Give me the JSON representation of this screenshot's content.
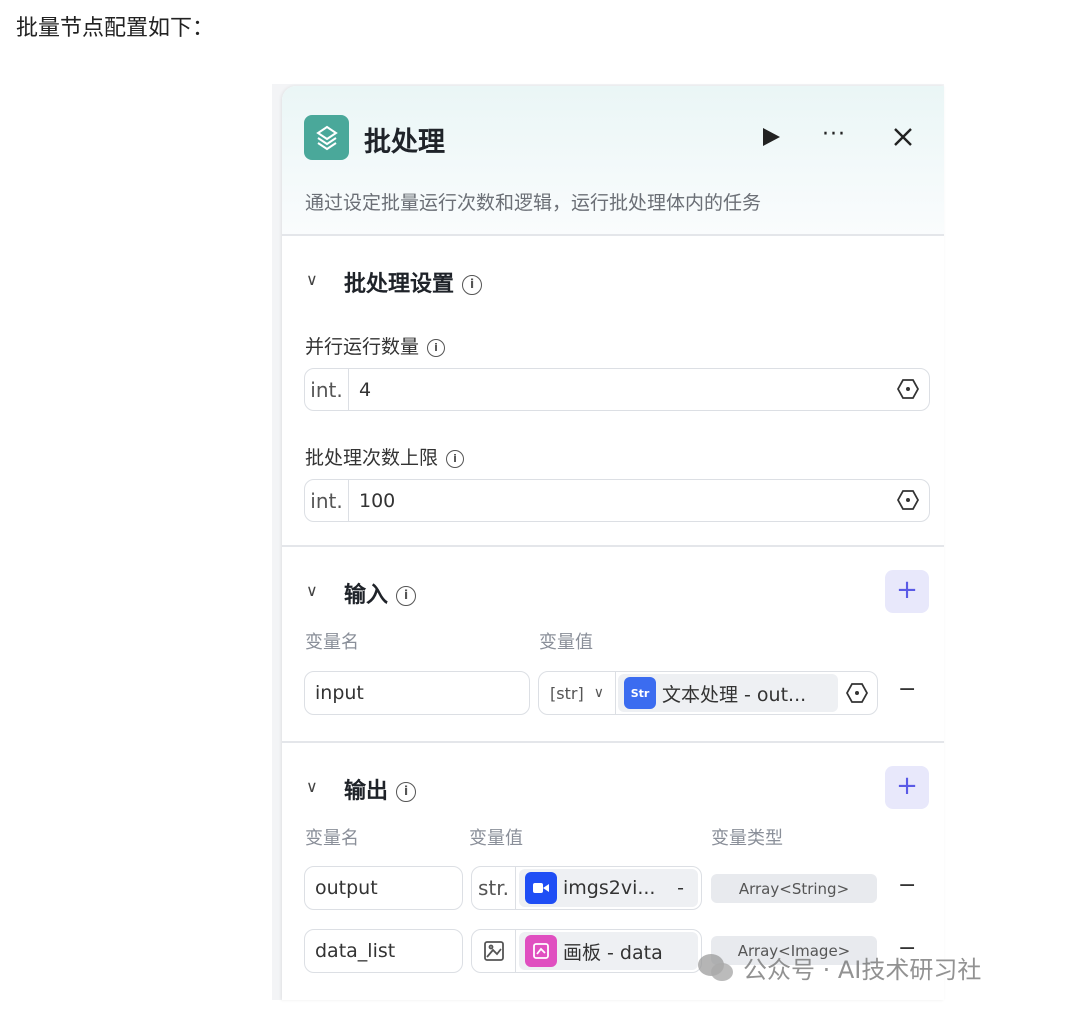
{
  "intro": "批量节点配置如下：",
  "panel": {
    "title": "批处理",
    "description": "通过设定批量运行次数和逻辑，运行批处理体内的任务",
    "icons": {
      "node": "layers-icon",
      "run": "play-icon",
      "more": "more-icon",
      "close": "close-icon"
    },
    "accent": "#4aa89a"
  },
  "settings": {
    "title": "批处理设置",
    "parallel": {
      "label": "并行运行数量",
      "type": "int.",
      "value": "4"
    },
    "limit": {
      "label": "批处理次数上限",
      "type": "int.",
      "value": "100"
    }
  },
  "input": {
    "title": "输入",
    "headers": {
      "name": "变量名",
      "value": "变量值"
    },
    "rows": [
      {
        "name": "input",
        "type": "[str]",
        "source": "文本处理 - out...",
        "source_icon": "Str"
      }
    ]
  },
  "output": {
    "title": "输出",
    "headers": {
      "name": "变量名",
      "value": "变量值",
      "type": "变量类型"
    },
    "rows": [
      {
        "name": "output",
        "type": "str.",
        "source": "imgs2vi...",
        "suffix": "-",
        "var_type": "Array<String>",
        "source_color": "#1f4ef5"
      },
      {
        "name": "data_list",
        "type": "image",
        "source": "画板 - data",
        "var_type": "Array<Image>",
        "source_color": "#e04fc0"
      }
    ]
  },
  "plus": "+",
  "minus": "−",
  "watermark": "公众号 · AI技术研习社"
}
